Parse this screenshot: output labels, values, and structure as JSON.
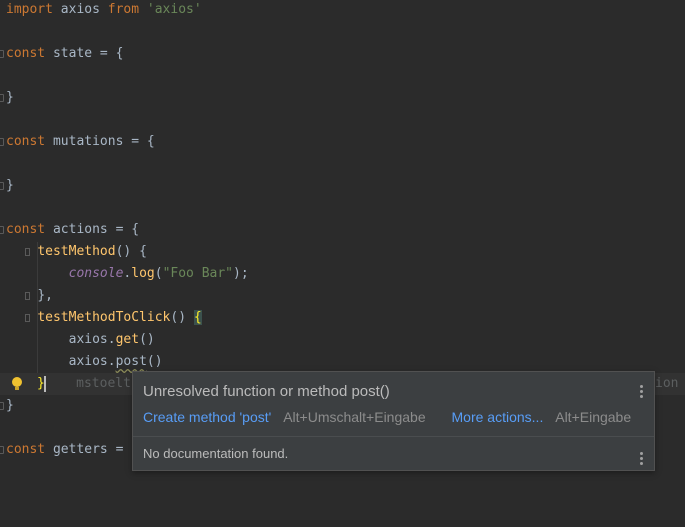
{
  "editor": {
    "lines": {
      "l1": {
        "kw": "import",
        "mid": " axios ",
        "kw2": "from",
        "sp": " ",
        "str": "'axios'"
      },
      "l3": {
        "kw": "const",
        "rest": " state = {"
      },
      "l5": {
        "rest": "}"
      },
      "l7": {
        "kw": "const",
        "rest": " mutations = {"
      },
      "l9": {
        "rest": "}"
      },
      "l11": {
        "kw": "const",
        "rest": " actions = {"
      },
      "l12": {
        "fn": "testMethod",
        "rest": "() {"
      },
      "l13": {
        "glob": "console",
        "dot": ".",
        "method": "log",
        "open": "(",
        "str": "\"Foo Bar\"",
        "close": ");"
      },
      "l14": {
        "rest": "},"
      },
      "l15": {
        "fn": "testMethodToClick",
        "rest": "() ",
        "brace": "{"
      },
      "l16": {
        "obj": "axios.",
        "method": "get",
        "rest": "()"
      },
      "l17": {
        "obj": "axios.",
        "method": "post",
        "rest": "()"
      },
      "l18": {
        "brace": "}",
        "hint": "mstoelti",
        "hint_right": "ion"
      },
      "l19": {
        "rest": "}"
      },
      "l21": {
        "kw": "const",
        "rest": " getters = "
      }
    }
  },
  "popup": {
    "title": "Unresolved function or method post()",
    "create_action": "Create method 'post'",
    "create_shortcut": "Alt+Umschalt+Eingabe",
    "more_actions": "More actions...",
    "more_shortcut": "Alt+Eingabe",
    "documentation": "No documentation found."
  },
  "icons": {
    "intention": "lightbulb-icon",
    "menu": "more-vertical-icon",
    "fold": "fold-marker-icon"
  },
  "colors": {
    "background": "#2b2b2b",
    "keyword": "#cc7832",
    "string": "#6a8759",
    "function": "#ffc66d",
    "global": "#9876aa",
    "link": "#589df6"
  }
}
